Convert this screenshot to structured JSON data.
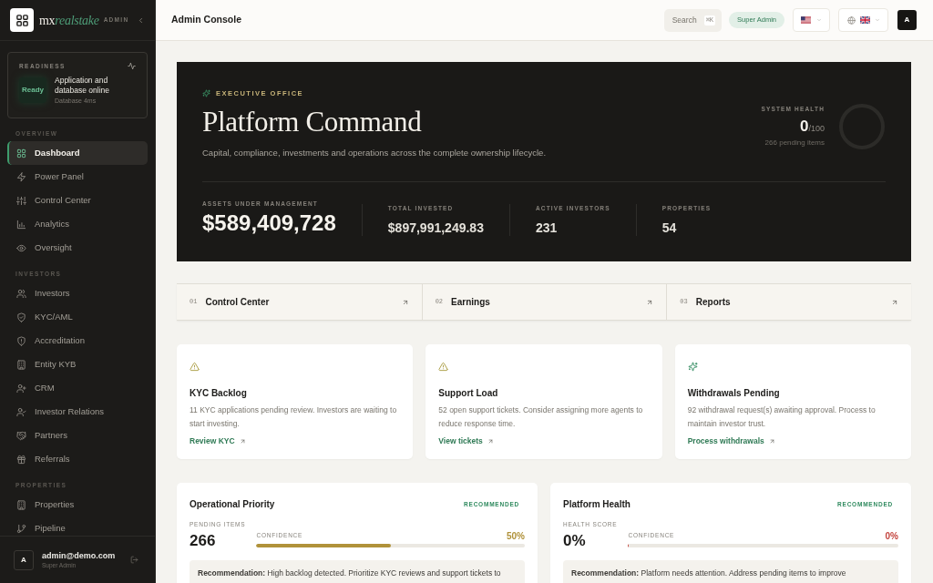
{
  "sidebar": {
    "brand": {
      "prefix": "mx",
      "name": "realstake"
    },
    "badge": "ADMIN",
    "readiness": {
      "label": "READINESS",
      "status": "Ready",
      "title": "Application and database online",
      "detail": "Database 4ms"
    },
    "sections": [
      {
        "heading": "OVERVIEW",
        "items": [
          {
            "label": "Dashboard",
            "selected": true
          },
          {
            "label": "Power Panel",
            "selected": false
          },
          {
            "label": "Control Center",
            "selected": false
          },
          {
            "label": "Analytics",
            "selected": false
          },
          {
            "label": "Oversight",
            "selected": false
          }
        ]
      },
      {
        "heading": "INVESTORS",
        "items": [
          {
            "label": "Investors",
            "selected": false
          },
          {
            "label": "KYC/AML",
            "selected": false
          },
          {
            "label": "Accreditation",
            "selected": false
          },
          {
            "label": "Entity KYB",
            "selected": false
          },
          {
            "label": "CRM",
            "selected": false
          },
          {
            "label": "Investor Relations",
            "selected": false
          },
          {
            "label": "Partners",
            "selected": false
          },
          {
            "label": "Referrals",
            "selected": false
          }
        ]
      },
      {
        "heading": "PROPERTIES",
        "items": [
          {
            "label": "Properties",
            "selected": false
          },
          {
            "label": "Pipeline",
            "selected": false
          }
        ]
      }
    ],
    "user": {
      "avatar": "A",
      "email": "admin@demo.com",
      "role": "Super Admin"
    }
  },
  "header": {
    "title": "Admin Console",
    "search": {
      "label": "Search",
      "shortcut": "⌘K"
    },
    "role_badge": "Super Admin",
    "avatar": "A"
  },
  "hero": {
    "eyebrow": "EXECUTIVE OFFICE",
    "title": "Platform Command",
    "subtitle": "Capital, compliance, investments and operations across the complete ownership lifecycle.",
    "health": {
      "label": "SYSTEM HEALTH",
      "score": "0",
      "max": "/100",
      "pending": "266 pending items",
      "level": 0
    },
    "stats": [
      {
        "kind": "primary",
        "label": "ASSETS UNDER MANAGEMENT",
        "value": "$589,409,728"
      },
      {
        "kind": "secondary",
        "label": "TOTAL INVESTED",
        "value": "$897,991,249.83"
      },
      {
        "kind": "secondary",
        "label": "ACTIVE INVESTORS",
        "value": "231"
      },
      {
        "kind": "secondary",
        "label": "PROPERTIES",
        "value": "54"
      }
    ]
  },
  "quick_links": [
    {
      "index": "01",
      "label": "Control Center"
    },
    {
      "index": "02",
      "label": "Earnings"
    },
    {
      "index": "03",
      "label": "Reports"
    }
  ],
  "alerts": [
    {
      "kind": "warning",
      "title": "KYC Backlog",
      "text": "11 KYC applications pending review. Investors are waiting to start investing.",
      "action": "Review KYC"
    },
    {
      "kind": "warning",
      "title": "Support Load",
      "text": "52 open support tickets. Consider assigning more agents to reduce response time.",
      "action": "View tickets"
    },
    {
      "kind": "task",
      "title": "Withdrawals Pending",
      "text": "92 withdrawal request(s) awaiting approval. Process to maintain investor trust.",
      "action": "Process withdrawals"
    }
  ],
  "insights": [
    {
      "title": "Operational Priority",
      "tag": "RECOMMENDED",
      "metric_label": "PENDING ITEMS",
      "metric": "266",
      "confidence_label": "CONFIDENCE",
      "confidence": "50%",
      "color": "#b0923a",
      "level": 0.5,
      "recommendation": "**Recommendation:** High backlog detected. Prioritize KYC reviews and support tickets to"
    },
    {
      "title": "Platform Health",
      "tag": "RECOMMENDED",
      "metric_label": "HEALTH SCORE",
      "metric": "0%",
      "confidence_label": "CONFIDENCE",
      "confidence": "0%",
      "color": "#c4453f",
      "level": 0,
      "recommendation": "**Recommendation:** Platform needs attention. Address pending items to improve"
    }
  ]
}
